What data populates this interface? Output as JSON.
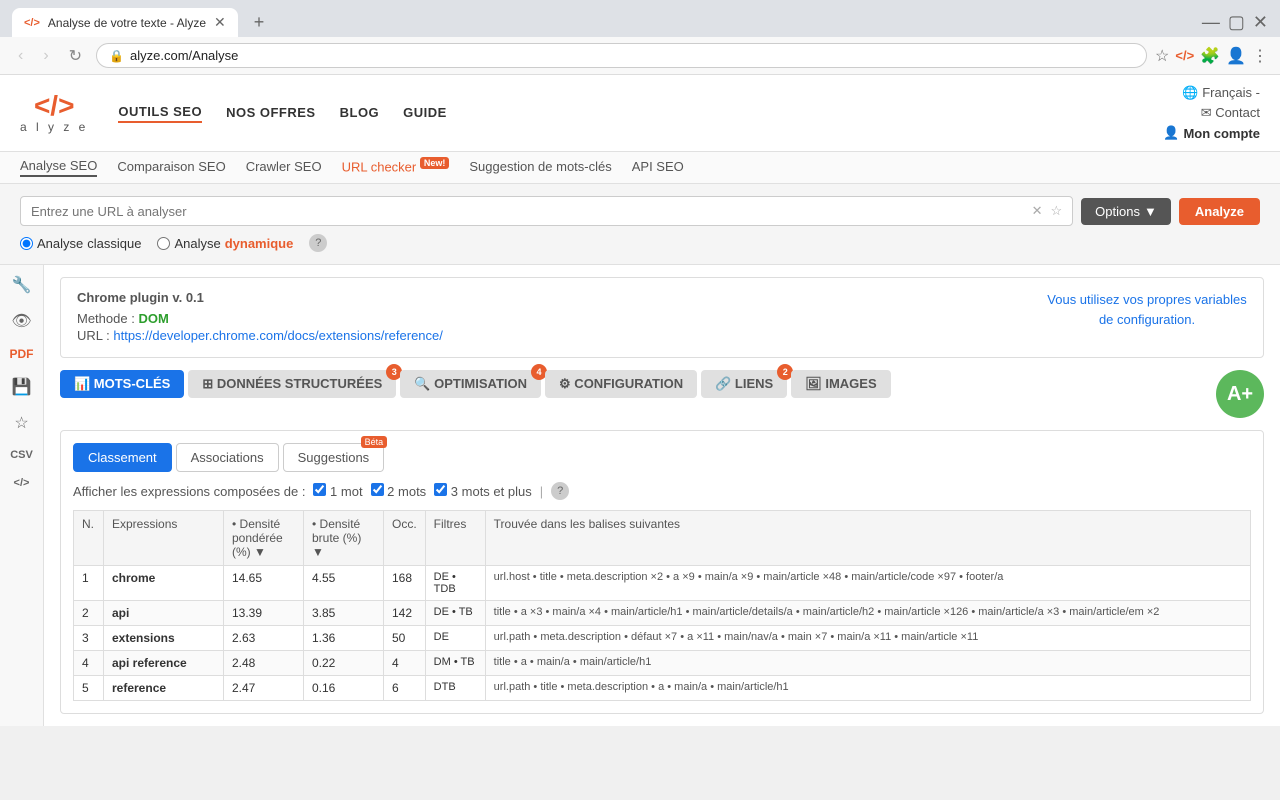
{
  "browser": {
    "tab_title": "Analyse de votre texte - Alyze",
    "tab_icon": "</>",
    "url": "alyze.com/Analyse",
    "new_tab_label": "+"
  },
  "topnav": {
    "logo_icon": "</>",
    "logo_text": "a l y z e",
    "nav_items": [
      "OUTILS SEO",
      "NOS OFFRES",
      "BLOG",
      "GUIDE"
    ],
    "active_nav": "OUTILS SEO",
    "lang": "Français",
    "contact": "Contact",
    "account": "Mon compte"
  },
  "subnav": {
    "items": [
      "Analyse SEO",
      "Comparaison SEO",
      "Crawler SEO",
      "URL checker",
      "Suggestion de mots-clés",
      "API SEO"
    ],
    "active": "Analyse SEO",
    "new_badge_item": "URL checker",
    "new_badge_text": "New!"
  },
  "searchbar": {
    "placeholder": "Entrez une URL à analyser",
    "options_label": "Options",
    "analyze_label": "Analyze",
    "radio1_label": "Analyse",
    "radio1_suffix": "classique",
    "radio2_label": "Analyse",
    "radio2_suffix": "dynamique",
    "help": "?"
  },
  "plugin_box": {
    "title": "Chrome plugin v. 0.1",
    "method_label": "Methode :",
    "method_value": "DOM",
    "url_label": "URL :",
    "url_value": "https://developer.chrome.com/docs/extensions/reference/",
    "side_text": "Vous utilisez vos propres variables de configuration."
  },
  "main_tabs": [
    {
      "label": "MOTS-CLÉS",
      "badge": null,
      "active": true,
      "icon": "chart"
    },
    {
      "label": "DONNÉES STRUCTURÉES",
      "badge": "3",
      "active": false,
      "icon": "structure"
    },
    {
      "label": "OPTIMISATION",
      "badge": "4",
      "active": false,
      "icon": "search"
    },
    {
      "label": "CONFIGURATION",
      "badge": null,
      "active": false,
      "icon": "gear"
    },
    {
      "label": "LIENS",
      "badge": "2",
      "active": false,
      "icon": "link"
    },
    {
      "label": "IMAGES",
      "badge": null,
      "active": false,
      "icon": "image"
    }
  ],
  "grade": "A+",
  "inner_tabs": [
    {
      "label": "Classement",
      "active": true,
      "badge": null
    },
    {
      "label": "Associations",
      "active": false,
      "badge": null
    },
    {
      "label": "Suggestions",
      "active": false,
      "badge": "Béta"
    }
  ],
  "filter_row": {
    "prefix": "Afficher les expressions composées de :",
    "checkboxes": [
      {
        "label": "1 mot",
        "checked": true
      },
      {
        "label": "2 mots",
        "checked": true
      },
      {
        "label": "3 mots et plus",
        "checked": true
      }
    ],
    "help": "?"
  },
  "table": {
    "columns": [
      "N.",
      "Expressions",
      "• Densité pondérée (%) ▼",
      "• Densité brute (%) ▼",
      "Occ.",
      "Filtres",
      "Trouvée dans les balises suivantes"
    ],
    "rows": [
      {
        "n": "1",
        "expr": "chrome",
        "density_pond": "14.65",
        "density_brute": "4.55",
        "occ": "168",
        "filtres": "DE • TDB",
        "balises": "url.host • title • meta.description ×2 • a ×9 • main/a ×9 • main/article ×48 • main/article/code ×97 • footer/a"
      },
      {
        "n": "2",
        "expr": "api",
        "density_pond": "13.39",
        "density_brute": "3.85",
        "occ": "142",
        "filtres": "DE • TB",
        "balises": "title • a ×3 • main/a ×4 • main/article/h1 • main/article/details/a • main/article/h2 • main/article ×126 • main/article/a ×3 • main/article/em ×2"
      },
      {
        "n": "3",
        "expr": "extensions",
        "density_pond": "2.63",
        "density_brute": "1.36",
        "occ": "50",
        "filtres": "DE",
        "balises": "url.path • meta.description • défaut ×7 • a ×11 • main/nav/a • main ×7 • main/a ×11 • main/article ×11"
      },
      {
        "n": "4",
        "expr": "api reference",
        "density_pond": "2.48",
        "density_brute": "0.22",
        "occ": "4",
        "filtres": "DM • TB",
        "balises": "title • a • main/a • main/article/h1"
      },
      {
        "n": "5",
        "expr": "reference",
        "density_pond": "2.47",
        "density_brute": "0.16",
        "occ": "6",
        "filtres": "DTB",
        "balises": "url.path • title • meta.description • a • main/a • main/article/h1"
      }
    ]
  },
  "sidebar_icons": [
    "wrench",
    "eye",
    "pdf",
    "save",
    "star",
    "csv",
    "code"
  ]
}
